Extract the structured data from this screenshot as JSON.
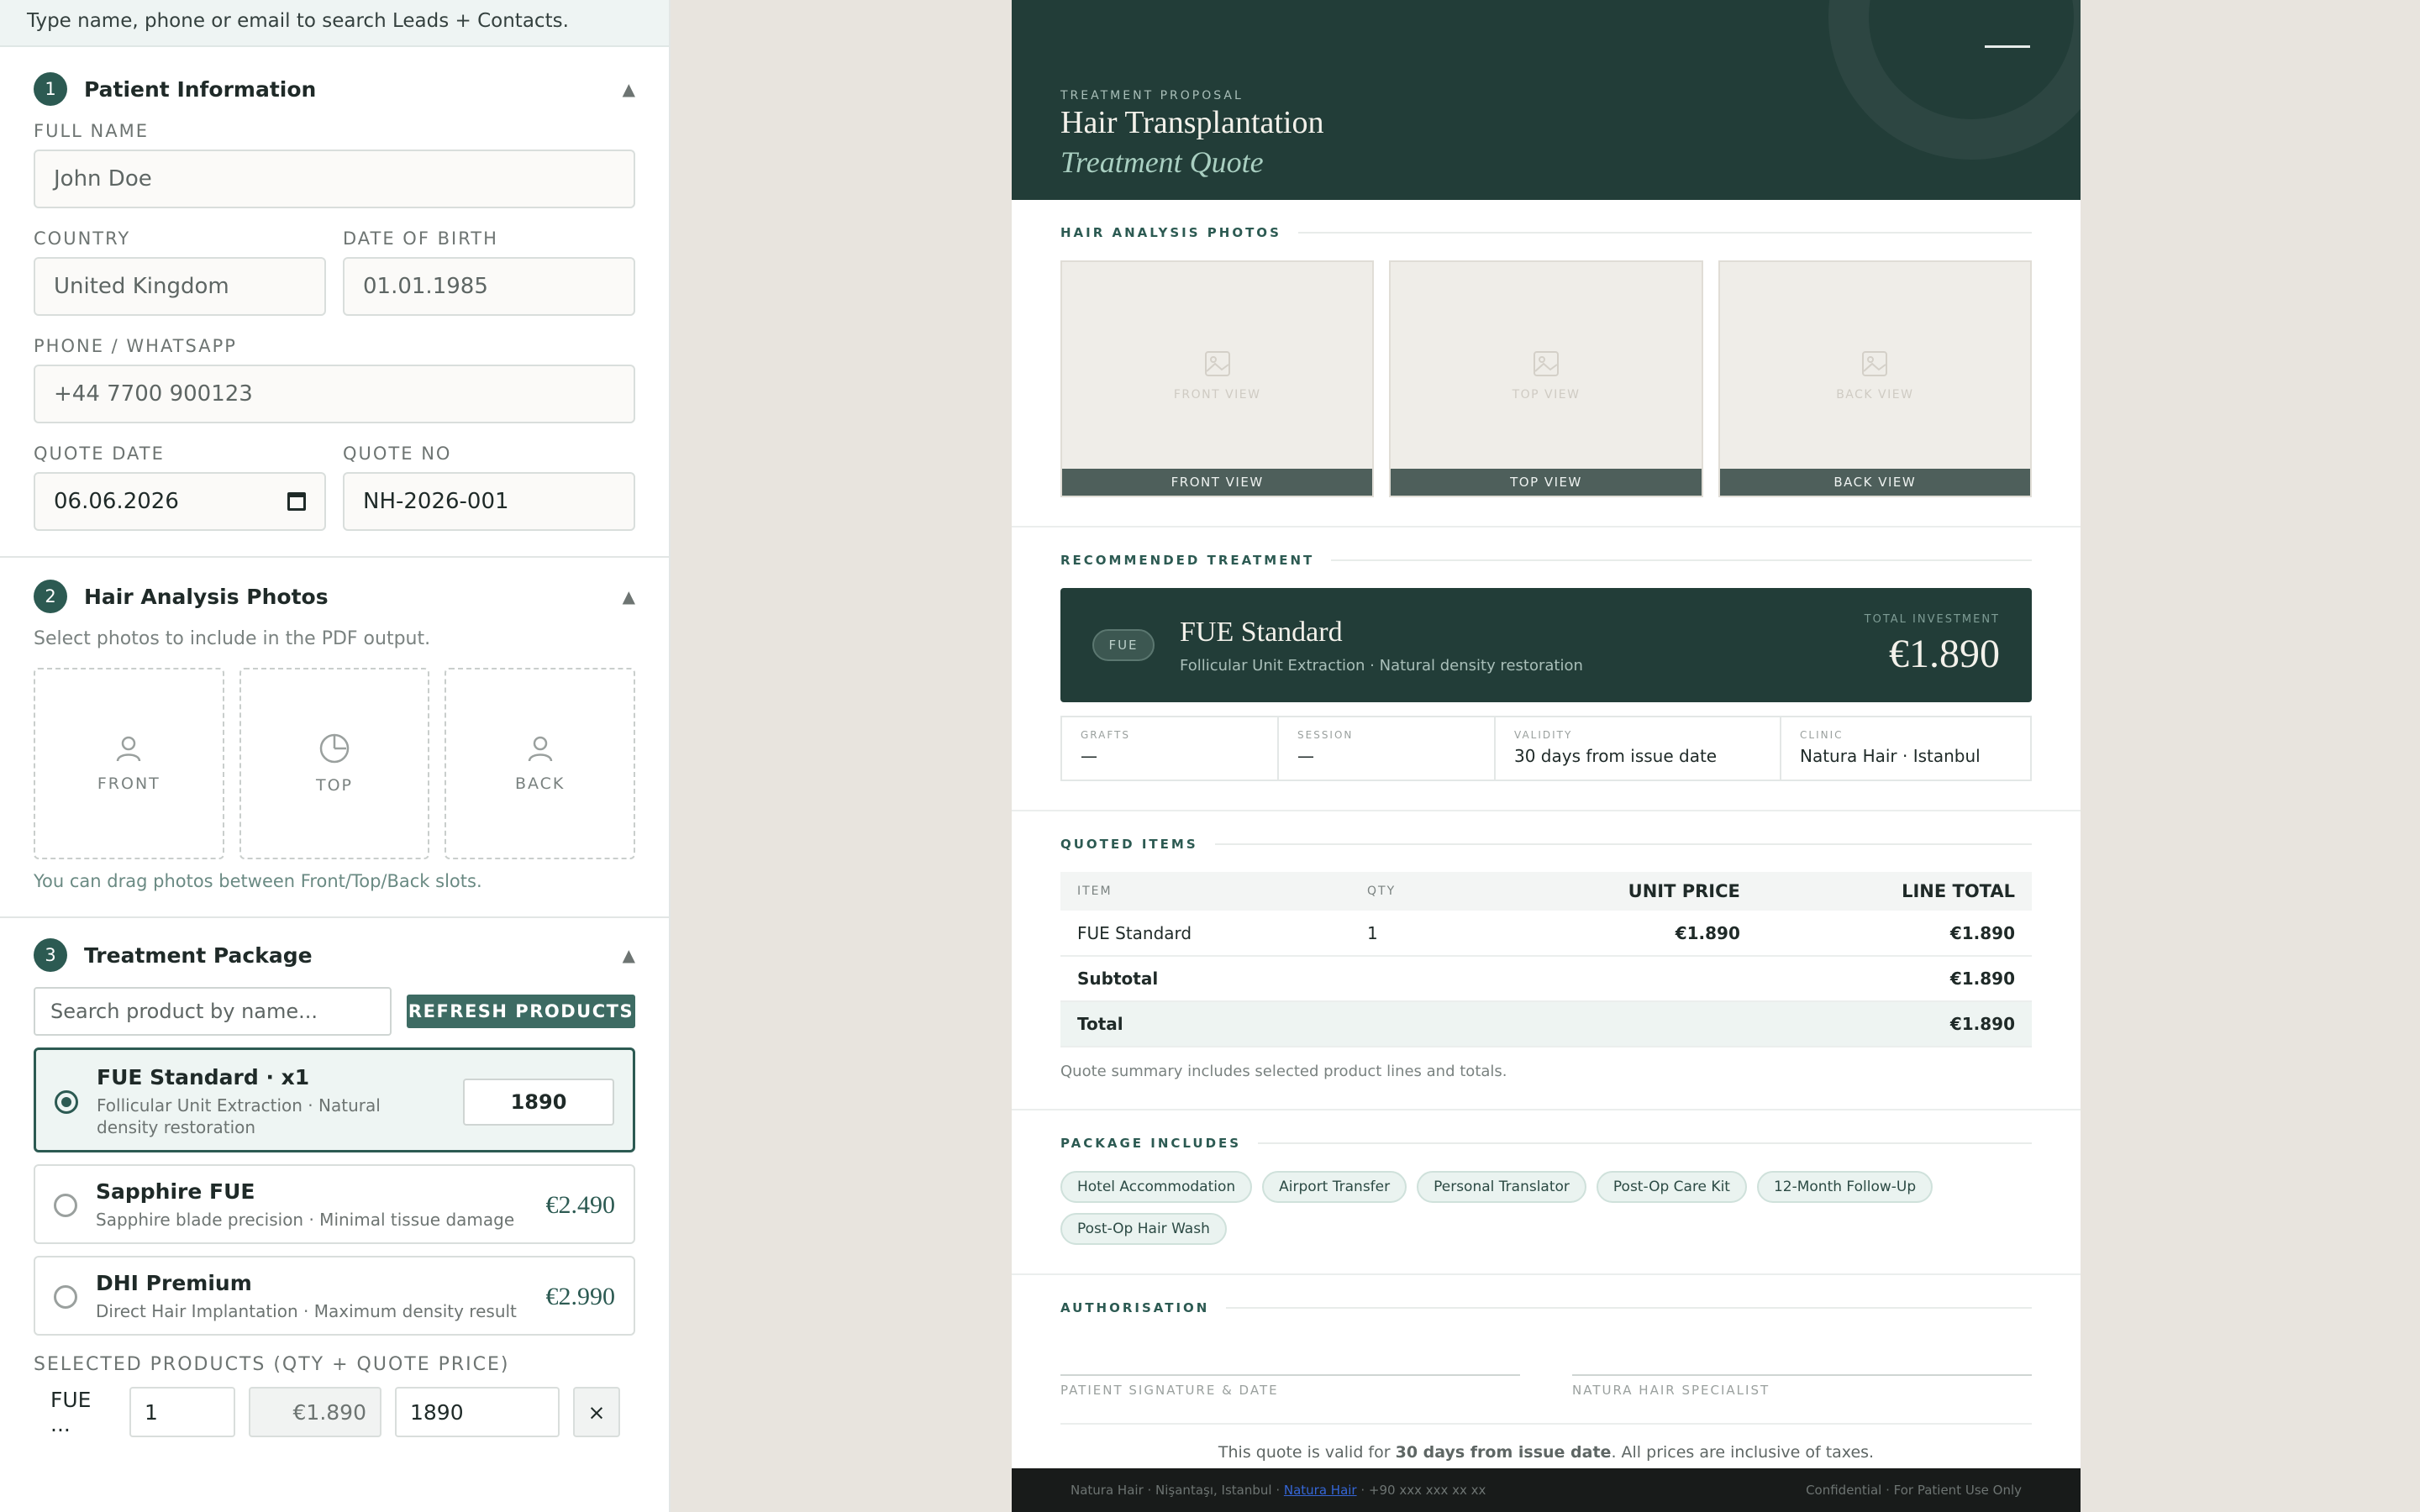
{
  "search_hint": "Type name, phone or email to search Leads + Contacts.",
  "sections": {
    "patient": {
      "num": "1",
      "title": "Patient Information",
      "full_name_label": "FULL NAME",
      "full_name_value": "John Doe",
      "country_label": "COUNTRY",
      "country_value": "United Kingdom",
      "dob_label": "DATE OF BIRTH",
      "dob_value": "01.01.1985",
      "phone_label": "PHONE / WHATSAPP",
      "phone_value": "+44 7700 900123",
      "quote_date_label": "QUOTE DATE",
      "quote_date_value": "06.06.2026",
      "quote_no_label": "QUOTE NO",
      "quote_no_value": "NH-2026-001"
    },
    "photos": {
      "num": "2",
      "title": "Hair Analysis Photos",
      "note": "Select photos to include in the PDF output.",
      "slots": [
        "FRONT",
        "TOP",
        "BACK"
      ],
      "drag_note": "You can drag photos between Front/Top/Back slots."
    },
    "package": {
      "num": "3",
      "title": "Treatment Package",
      "search_placeholder": "Search product by name...",
      "refresh_label": "REFRESH PRODUCTS",
      "products": [
        {
          "name": "FUE Standard · x1",
          "desc": "Follicular Unit Extraction · Natural density restoration",
          "price_input": "1890",
          "selected": true
        },
        {
          "name": "Sapphire FUE",
          "desc": "Sapphire blade precision · Minimal tissue damage",
          "price": "€2.490",
          "selected": false
        },
        {
          "name": "DHI Premium",
          "desc": "Direct Hair Implantation · Maximum density result",
          "price": "€2.990",
          "selected": false
        }
      ],
      "selected_label": "SELECTED PRODUCTS (QTY + QUOTE PRICE)",
      "selected_row": {
        "name": "FUE ...",
        "qty": "1",
        "unit": "€1.890",
        "quote": "1890",
        "remove": "×"
      }
    }
  },
  "doc": {
    "eyebrow": "TREATMENT PROPOSAL",
    "title": "Hair Transplantation",
    "subtitle": "Treatment Quote",
    "photos_heading": "HAIR ANALYSIS PHOTOS",
    "photos": [
      {
        "ghost": "FRONT VIEW",
        "bar": "FRONT VIEW"
      },
      {
        "ghost": "TOP VIEW",
        "bar": "TOP VIEW"
      },
      {
        "ghost": "BACK VIEW",
        "bar": "BACK VIEW"
      }
    ],
    "recommended_heading": "RECOMMENDED TREATMENT",
    "treatment": {
      "pill": "FUE",
      "name": "FUE Standard",
      "desc": "Follicular Unit Extraction · Natural density restoration",
      "invest_label": "TOTAL INVESTMENT",
      "invest_value": "€1.890"
    },
    "facts": [
      {
        "k": "GRAFTS",
        "v": "—"
      },
      {
        "k": "SESSION",
        "v": "—"
      },
      {
        "k": "VALIDITY",
        "v": "30 days from issue date"
      },
      {
        "k": "CLINIC",
        "v": "Natura Hair · Istanbul"
      }
    ],
    "quoted_heading": "QUOTED ITEMS",
    "table_headers": {
      "item": "ITEM",
      "qty": "QTY",
      "unit": "UNIT PRICE",
      "line": "LINE TOTAL"
    },
    "table_rows": [
      {
        "item": "FUE Standard",
        "qty": "1",
        "unit": "€1.890",
        "line": "€1.890"
      }
    ],
    "subtotal_label": "Subtotal",
    "subtotal_value": "€1.890",
    "total_label": "Total",
    "total_value": "€1.890",
    "summary_note": "Quote summary includes selected product lines and totals.",
    "includes_heading": "PACKAGE INCLUDES",
    "includes": [
      "Hotel Accommodation",
      "Airport Transfer",
      "Personal Translator",
      "Post-Op Care Kit",
      "12-Month Follow-Up",
      "Post-Op Hair Wash"
    ],
    "auth_heading": "AUTHORISATION",
    "sig_patient": "PATIENT SIGNATURE & DATE",
    "sig_specialist": "NATURA HAIR SPECIALIST",
    "valid_prefix": "This quote is valid for ",
    "valid_bold": "30 days from issue date",
    "valid_suffix": ". All prices are inclusive of taxes.",
    "footer_left": "Natura Hair · Nişantaşı, Istanbul · ",
    "footer_link": "Natura Hair",
    "footer_phone": " · +90 xxx xxx xx xx",
    "footer_right": "Confidential · For Patient Use Only"
  }
}
